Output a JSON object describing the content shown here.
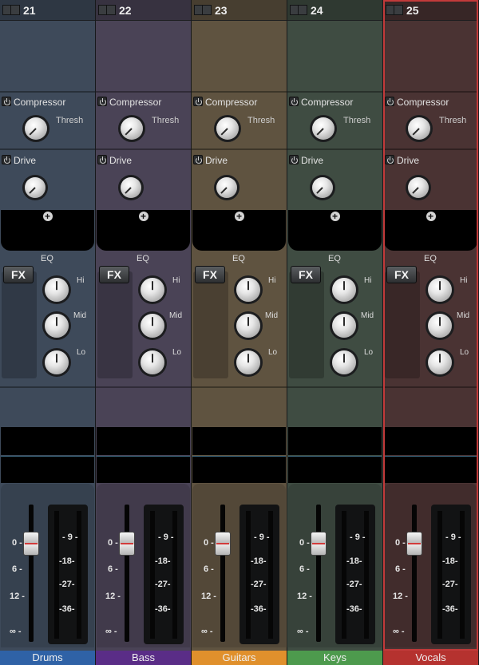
{
  "channels": [
    {
      "number": "21",
      "name": "Drums",
      "selected": false,
      "color": "#2f62a6",
      "tint": "#3e4a5a",
      "plugins": {
        "compressor": "Compressor",
        "thresh": "Thresh",
        "drive": "Drive"
      },
      "eq": {
        "title": "EQ",
        "fx": "FX",
        "hi": "Hi",
        "mid": "Mid",
        "lo": "Lo"
      },
      "scale": [
        "0",
        "6",
        "12",
        "∞"
      ],
      "meter_scale": [
        "9",
        "18",
        "27",
        "36"
      ]
    },
    {
      "number": "22",
      "name": "Bass",
      "selected": false,
      "color": "#5a2d87",
      "tint": "#4a4356",
      "plugins": {
        "compressor": "Compressor",
        "thresh": "Thresh",
        "drive": "Drive"
      },
      "eq": {
        "title": "EQ",
        "fx": "FX",
        "hi": "Hi",
        "mid": "Mid",
        "lo": "Lo"
      },
      "scale": [
        "0",
        "6",
        "12",
        "∞"
      ],
      "meter_scale": [
        "9",
        "18",
        "27",
        "36"
      ]
    },
    {
      "number": "23",
      "name": "Guitars",
      "selected": false,
      "color": "#e0902c",
      "tint": "#5f5340",
      "plugins": {
        "compressor": "Compressor",
        "thresh": "Thresh",
        "drive": "Drive"
      },
      "eq": {
        "title": "EQ",
        "fx": "FX",
        "hi": "Hi",
        "mid": "Mid",
        "lo": "Lo"
      },
      "scale": [
        "0",
        "6",
        "12",
        "∞"
      ],
      "meter_scale": [
        "9",
        "18",
        "27",
        "36"
      ]
    },
    {
      "number": "24",
      "name": "Keys",
      "selected": false,
      "color": "#4d9a4d",
      "tint": "#3f4c42",
      "plugins": {
        "compressor": "Compressor",
        "thresh": "Thresh",
        "drive": "Drive"
      },
      "eq": {
        "title": "EQ",
        "fx": "FX",
        "hi": "Hi",
        "mid": "Mid",
        "lo": "Lo"
      },
      "scale": [
        "0",
        "6",
        "12",
        "∞"
      ],
      "meter_scale": [
        "9",
        "18",
        "27",
        "36"
      ]
    },
    {
      "number": "25",
      "name": "Vocals",
      "selected": true,
      "color": "#b5322f",
      "tint": "#4a3333",
      "plugins": {
        "compressor": "Compressor",
        "thresh": "Thresh",
        "drive": "Drive"
      },
      "eq": {
        "title": "EQ",
        "fx": "FX",
        "hi": "Hi",
        "mid": "Mid",
        "lo": "Lo"
      },
      "scale": [
        "0",
        "6",
        "12",
        "∞"
      ],
      "meter_scale": [
        "9",
        "18",
        "27",
        "36"
      ]
    }
  ]
}
